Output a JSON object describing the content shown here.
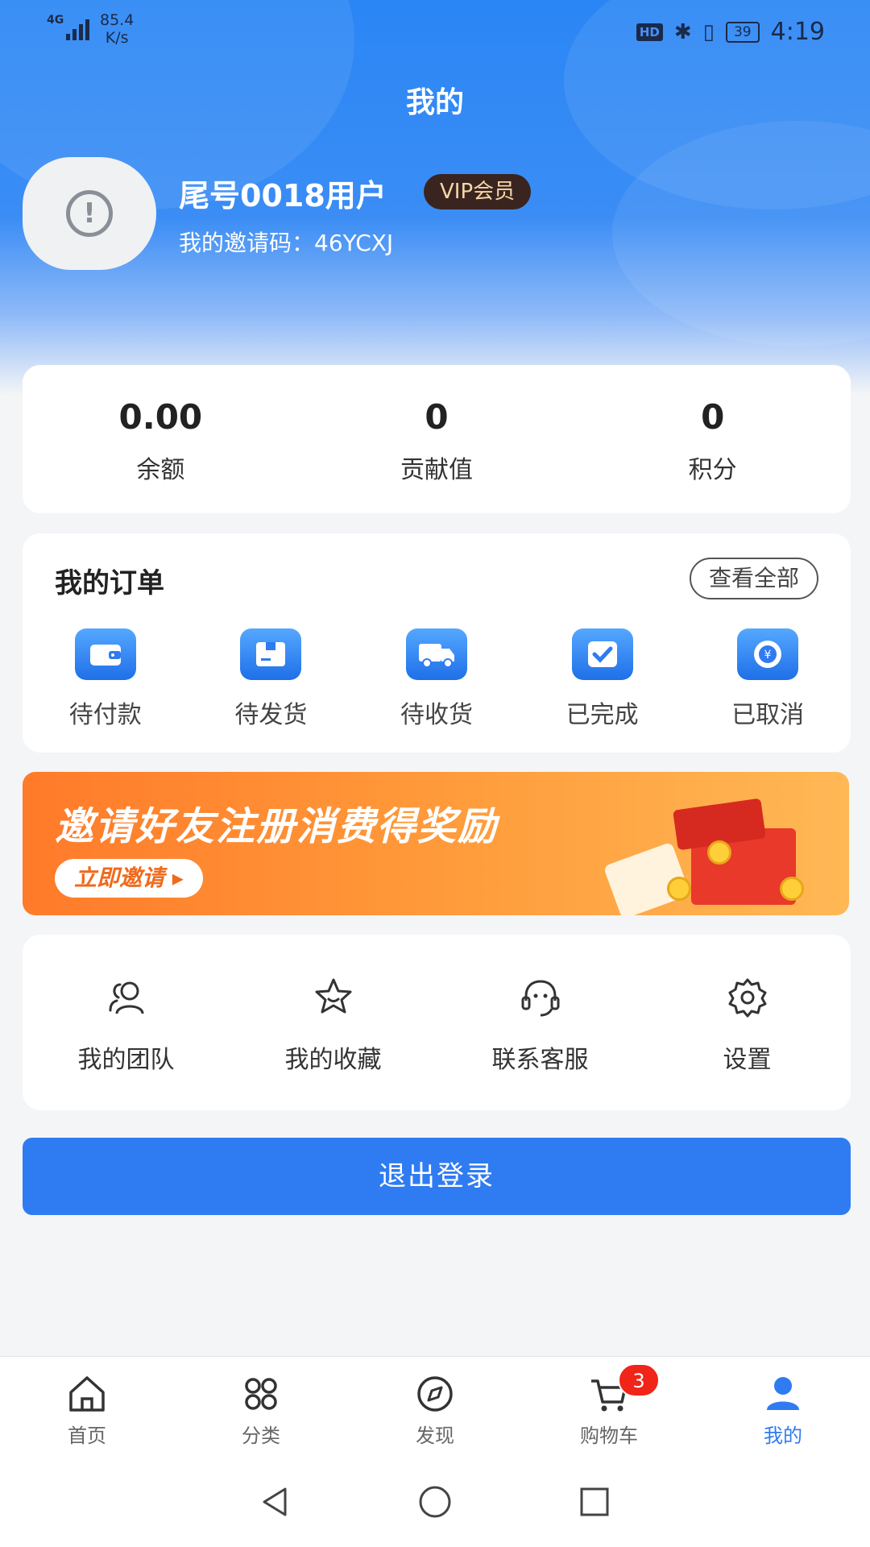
{
  "status_bar": {
    "network": "4G",
    "speed": "85.4",
    "speed_unit": "K/s",
    "hd": "HD",
    "battery": "39",
    "time": "4:19"
  },
  "page": {
    "title": "我的"
  },
  "profile": {
    "name": "尾号0018用户",
    "badge": "VIP会员",
    "invite_line": "我的邀请码：46YCXJ"
  },
  "stats": [
    {
      "value": "0.00",
      "label": "余额"
    },
    {
      "value": "0",
      "label": "贡献值"
    },
    {
      "value": "0",
      "label": "积分"
    }
  ],
  "orders": {
    "title": "我的订单",
    "view_all": "查看全部",
    "items": [
      {
        "label": "待付款",
        "icon": "wallet-icon"
      },
      {
        "label": "待发货",
        "icon": "box-icon"
      },
      {
        "label": "待收货",
        "icon": "truck-icon"
      },
      {
        "label": "已完成",
        "icon": "check-icon"
      },
      {
        "label": "已取消",
        "icon": "refund-icon"
      }
    ]
  },
  "banner": {
    "headline": "邀请好友注册消费得奖励",
    "button": "立即邀请 ▸"
  },
  "tools": [
    {
      "label": "我的团队",
      "icon": "team-icon"
    },
    {
      "label": "我的收藏",
      "icon": "star-icon"
    },
    {
      "label": "联系客服",
      "icon": "headset-icon"
    },
    {
      "label": "设置",
      "icon": "gear-icon"
    }
  ],
  "logout": {
    "label": "退出登录"
  },
  "tabbar": {
    "items": [
      {
        "label": "首页",
        "icon": "home-icon",
        "active": false
      },
      {
        "label": "分类",
        "icon": "category-icon",
        "active": false
      },
      {
        "label": "发现",
        "icon": "compass-icon",
        "active": false
      },
      {
        "label": "购物车",
        "icon": "cart-icon",
        "active": false
      },
      {
        "label": "我的",
        "icon": "user-icon",
        "active": true
      }
    ],
    "cart_badge": "3"
  },
  "colors": {
    "primary": "#2f7bf2",
    "badge_red": "#f02418",
    "banner_orange": "#ff8a30",
    "vip_bg": "#3a2420"
  }
}
